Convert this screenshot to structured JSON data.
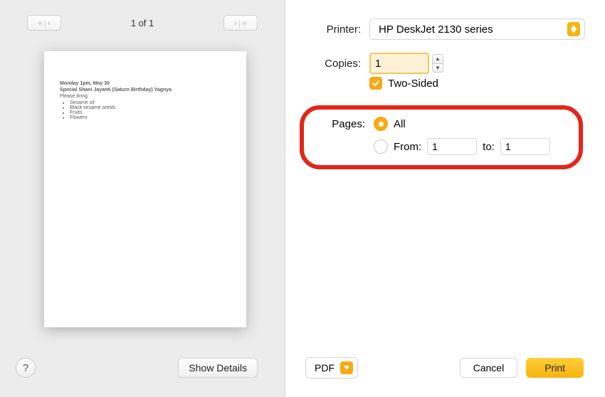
{
  "preview": {
    "page_indicator": "1 of 1",
    "sheet": {
      "line1": "Monday 1pm, May 30",
      "line2": "Special Shani Jayanti (Saturn Birthday) Yagnya",
      "line3": "Please bring:",
      "items": [
        "Sesame oil",
        "Black sesame seeds",
        "Fruits",
        "Flowers"
      ]
    },
    "show_details": "Show Details",
    "help": "?"
  },
  "options": {
    "printer_label": "Printer:",
    "printer_value": "HP DeskJet 2130 series",
    "copies_label": "Copies:",
    "copies_value": "1",
    "two_sided_label": "Two-Sided",
    "pages_label": "Pages:",
    "pages_all": "All",
    "pages_from_label": "From:",
    "pages_from_value": "1",
    "pages_to_label": "to:",
    "pages_to_value": "1"
  },
  "footer": {
    "pdf": "PDF",
    "cancel": "Cancel",
    "print": "Print"
  }
}
